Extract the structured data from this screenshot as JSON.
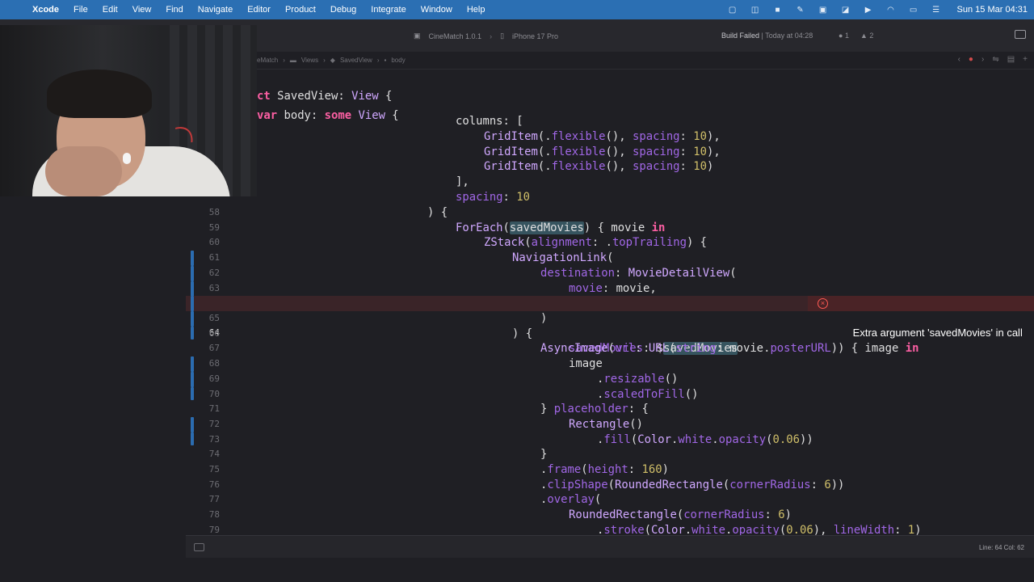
{
  "menubar": {
    "app": "Xcode",
    "menus": [
      "File",
      "Edit",
      "View",
      "Find",
      "Navigate",
      "Editor",
      "Product",
      "Debug",
      "Integrate",
      "Window",
      "Help"
    ],
    "clock": "Sun 15 Mar  04:31"
  },
  "toolbar": {
    "scheme": "CineMatch 1.0.1",
    "device": "iPhone 17 Pro",
    "build_status": "Build Failed",
    "build_time": "| Today at 04:28",
    "errors": "1",
    "warnings": "2"
  },
  "jumpbar": {
    "crumbs": [
      "eMatch",
      "Views",
      "SavedView",
      "body"
    ]
  },
  "code": {
    "header1": "ct SavedView: View {",
    "header2": "var body: some View {"
  },
  "error": {
    "line": "64",
    "message": "Extra argument 'savedMovies' in call"
  },
  "statusbar": {
    "position": "Line: 64  Col: 62"
  }
}
